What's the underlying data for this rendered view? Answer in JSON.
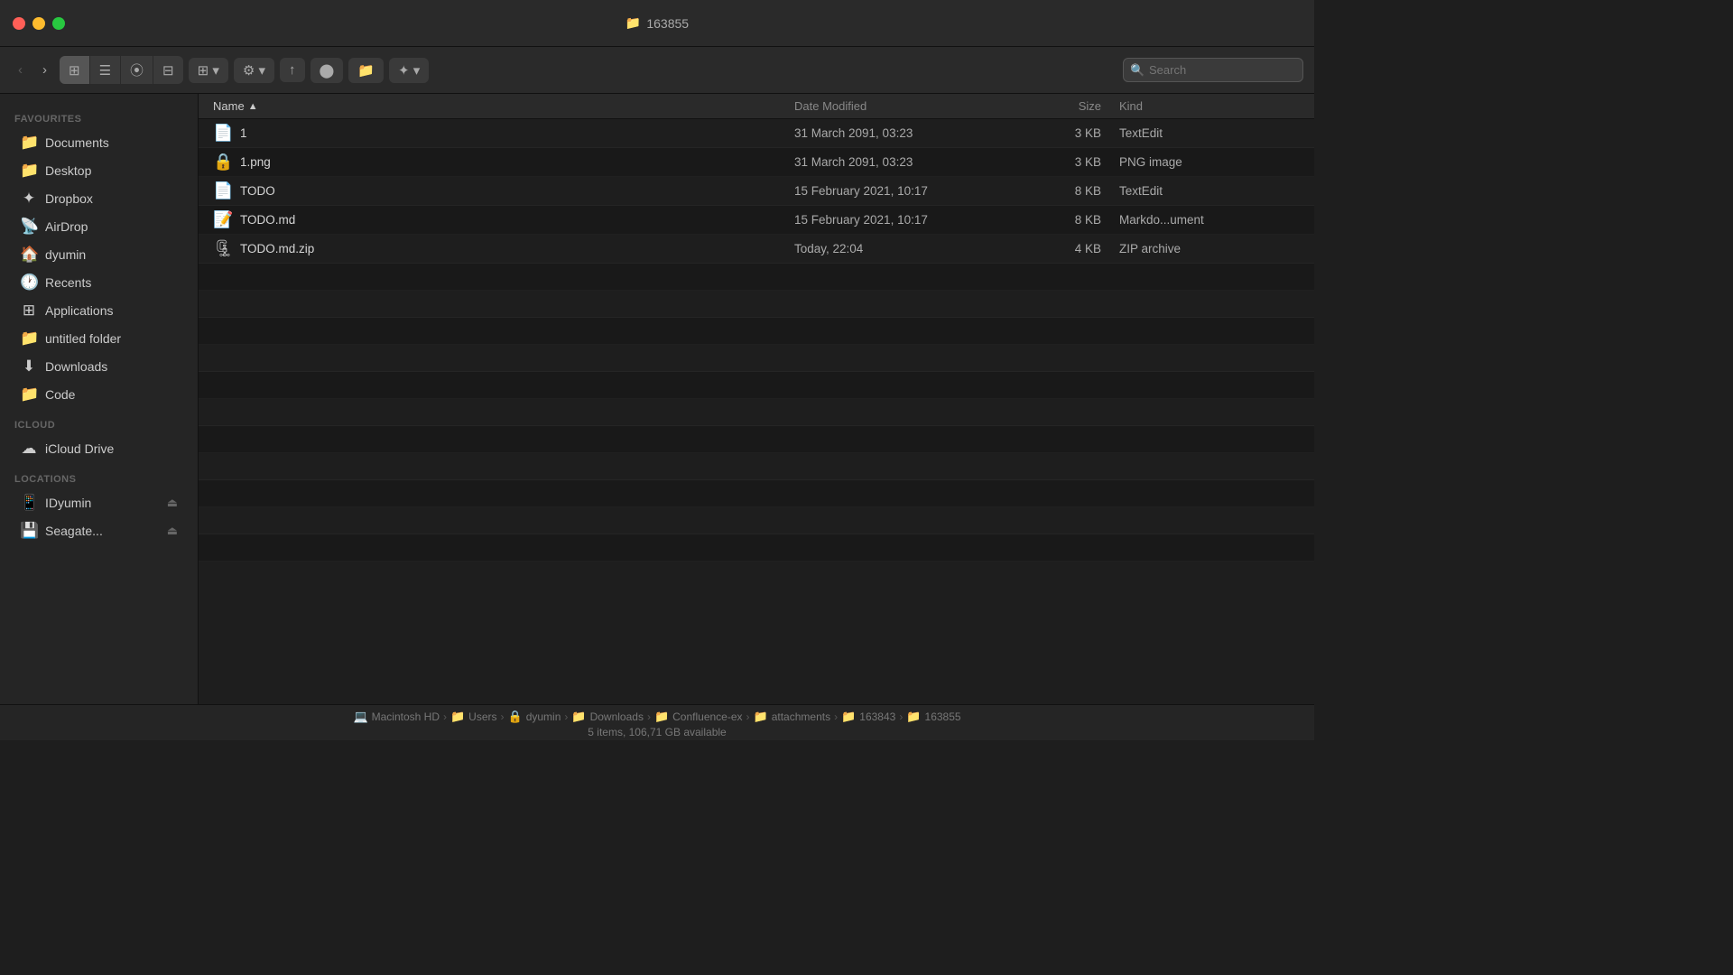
{
  "window": {
    "title": "163855",
    "controls": {
      "close": "close",
      "minimize": "minimize",
      "maximize": "maximize"
    }
  },
  "toolbar": {
    "back_label": "‹",
    "forward_label": "›",
    "view_icon": "⊞",
    "view_list": "☰",
    "view_columns": "⦿",
    "view_cover": "⊟",
    "group_label": "⊞ ▾",
    "action_label": "⚙ ▾",
    "share_label": "↑",
    "tag_label": "⬤",
    "new_folder_label": "📁",
    "dropbox_label": "✦ ▾",
    "search_placeholder": "Search"
  },
  "sidebar": {
    "favourites_label": "Favourites",
    "items_favourites": [
      {
        "id": "documents",
        "label": "Documents",
        "icon": "📁"
      },
      {
        "id": "desktop",
        "label": "Desktop",
        "icon": "📁"
      },
      {
        "id": "dropbox",
        "label": "Dropbox",
        "icon": "✦"
      },
      {
        "id": "airdrop",
        "label": "AirDrop",
        "icon": "📡"
      },
      {
        "id": "dyumin",
        "label": "dyumin",
        "icon": "🏠"
      },
      {
        "id": "recents",
        "label": "Recents",
        "icon": "🕐"
      },
      {
        "id": "applications",
        "label": "Applications",
        "icon": "⊞"
      },
      {
        "id": "untitled-folder",
        "label": "untitled folder",
        "icon": "📁"
      },
      {
        "id": "downloads",
        "label": "Downloads",
        "icon": "⬇"
      },
      {
        "id": "code",
        "label": "Code",
        "icon": "📁"
      }
    ],
    "icloud_label": "iCloud",
    "items_icloud": [
      {
        "id": "icloud-drive",
        "label": "iCloud Drive",
        "icon": "☁"
      }
    ],
    "locations_label": "Locations",
    "items_locations": [
      {
        "id": "idyumin",
        "label": "IDyumin",
        "icon": "📱",
        "eject": true
      },
      {
        "id": "seagate",
        "label": "Seagate...",
        "icon": "💾",
        "eject": true
      }
    ]
  },
  "file_list": {
    "columns": {
      "name": "Name",
      "date_modified": "Date Modified",
      "size": "Size",
      "kind": "Kind"
    },
    "sort_column": "name",
    "sort_direction": "asc",
    "files": [
      {
        "id": "file-1",
        "name": "1",
        "icon": "📄",
        "date_modified": "31 March 2091, 03:23",
        "size": "3 KB",
        "kind": "TextEdit"
      },
      {
        "id": "file-1png",
        "name": "1.png",
        "icon": "🔒",
        "date_modified": "31 March 2091, 03:23",
        "size": "3 KB",
        "kind": "PNG image"
      },
      {
        "id": "file-todo",
        "name": "TODO",
        "icon": "📄",
        "date_modified": "15 February 2021, 10:17",
        "size": "8 KB",
        "kind": "TextEdit"
      },
      {
        "id": "file-todomd",
        "name": "TODO.md",
        "icon": "📝",
        "date_modified": "15 February 2021, 10:17",
        "size": "8 KB",
        "kind": "Markdo...ument"
      },
      {
        "id": "file-todomdzip",
        "name": "TODO.md.zip",
        "icon": "🗜",
        "date_modified": "Today, 22:04",
        "size": "4 KB",
        "kind": "ZIP archive"
      }
    ]
  },
  "status_bar": {
    "items_count": "5 items, 106,71 GB available",
    "breadcrumb": [
      {
        "label": "Macintosh HD",
        "icon": "💻"
      },
      {
        "label": "Users",
        "icon": "📁"
      },
      {
        "label": "dyumin",
        "icon": "🔒"
      },
      {
        "label": "Downloads",
        "icon": "📁"
      },
      {
        "label": "Confluence-ex",
        "icon": "📁"
      },
      {
        "label": "attachments",
        "icon": "📁"
      },
      {
        "label": "163843",
        "icon": "📁"
      },
      {
        "label": "163855",
        "icon": "📁"
      }
    ]
  }
}
